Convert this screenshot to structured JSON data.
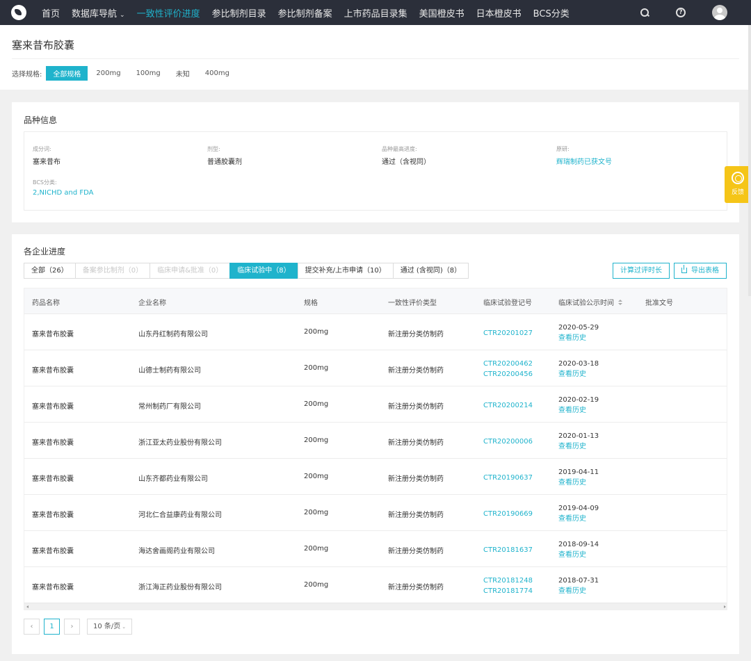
{
  "nav": {
    "items": [
      {
        "label": "首页",
        "active": false
      },
      {
        "label": "数据库导航",
        "active": false,
        "dropdown": true
      },
      {
        "label": "一致性评价进度",
        "active": true
      },
      {
        "label": "参比制剂目录",
        "active": false
      },
      {
        "label": "参比制剂备案",
        "active": false
      },
      {
        "label": "上市药品目录集",
        "active": false
      },
      {
        "label": "美国橙皮书",
        "active": false
      },
      {
        "label": "日本橙皮书",
        "active": false
      },
      {
        "label": "BCS分类",
        "active": false
      }
    ],
    "dropdown_caret": "⌄",
    "help_glyph": "?"
  },
  "header": {
    "title": "塞来昔布胶囊",
    "spec_label": "选择规格:",
    "spec_options": [
      "全部规格",
      "200mg",
      "100mg",
      "未知",
      "400mg"
    ],
    "spec_selected": "全部规格"
  },
  "info": {
    "title": "品种信息",
    "fields": {
      "ingredient": {
        "label": "成分词:",
        "value": "塞来昔布"
      },
      "dosage_form": {
        "label": "剂型:",
        "value": "普通胶囊剂"
      },
      "latest_progress": {
        "label": "品种最高进度:",
        "value": "通过（含视同）"
      },
      "original": {
        "label": "原研:",
        "value": "辉瑞制药已获文号"
      },
      "bcs": {
        "label": "BCS分类:",
        "value": "2,NICHD and FDA"
      }
    }
  },
  "feedback": {
    "label": "反馈"
  },
  "progress": {
    "title": "各企业进度",
    "tabs": [
      {
        "label": "全部（26）",
        "state": "normal"
      },
      {
        "label": "备案参比制剂（0）",
        "state": "disabled"
      },
      {
        "label": "临床申请&批准（0）",
        "state": "disabled"
      },
      {
        "label": "临床试验中（8）",
        "state": "active"
      },
      {
        "label": "提交补充/上市申请（10）",
        "state": "normal"
      },
      {
        "label": "通过 (含视同)（8）",
        "state": "normal"
      }
    ],
    "calc_button": "计算过评时长",
    "export_button": "导出表格",
    "columns": [
      "药品名称",
      "企业名称",
      "规格",
      "一致性评价类型",
      "临床试验登记号",
      "临床试验公示时间",
      "批准文号"
    ],
    "rows": [
      {
        "drug": "塞来昔布胶囊",
        "company": "山东丹红制药有限公司",
        "spec": "200mg",
        "type": "新注册分类仿制药",
        "trial_ids": [
          "CTR20201027"
        ],
        "date": "2020-05-29",
        "history": "查看历史",
        "approval": ""
      },
      {
        "drug": "塞来昔布胶囊",
        "company": "山德士制药有限公司",
        "spec": "200mg",
        "type": "新注册分类仿制药",
        "trial_ids": [
          "CTR20200462",
          "CTR20200456"
        ],
        "date": "2020-03-18",
        "history": "查看历史",
        "approval": ""
      },
      {
        "drug": "塞来昔布胶囊",
        "company": "常州制药厂有限公司",
        "spec": "200mg",
        "type": "新注册分类仿制药",
        "trial_ids": [
          "CTR20200214"
        ],
        "date": "2020-02-19",
        "history": "查看历史",
        "approval": ""
      },
      {
        "drug": "塞来昔布胶囊",
        "company": "浙江亚太药业股份有限公司",
        "spec": "200mg",
        "type": "新注册分类仿制药",
        "trial_ids": [
          "CTR20200006"
        ],
        "date": "2020-01-13",
        "history": "查看历史",
        "approval": ""
      },
      {
        "drug": "塞来昔布胶囊",
        "company": "山东齐都药业有限公司",
        "spec": "200mg",
        "type": "新注册分类仿制药",
        "trial_ids": [
          "CTR20190637"
        ],
        "date": "2019-04-11",
        "history": "查看历史",
        "approval": ""
      },
      {
        "drug": "塞来昔布胶囊",
        "company": "河北仁合益康药业有限公司",
        "spec": "200mg",
        "type": "新注册分类仿制药",
        "trial_ids": [
          "CTR20190669"
        ],
        "date": "2019-04-09",
        "history": "查看历史",
        "approval": ""
      },
      {
        "drug": "塞来昔布胶囊",
        "company": "海达舍画阁药业有限公司",
        "spec": "200mg",
        "type": "新注册分类仿制药",
        "trial_ids": [
          "CTR20181637"
        ],
        "date": "2018-09-14",
        "history": "查看历史",
        "approval": ""
      },
      {
        "drug": "塞来昔布胶囊",
        "company": "浙江海正药业股份有限公司",
        "spec": "200mg",
        "type": "新注册分类仿制药",
        "trial_ids": [
          "CTR20181248",
          "CTR20181774"
        ],
        "date": "2018-07-31",
        "history": "查看历史",
        "approval": ""
      }
    ]
  },
  "pagination": {
    "prev": "‹",
    "next": "›",
    "current_page": "1",
    "page_size": "10 条/页",
    "size_caret": "⌄"
  },
  "colors": {
    "accent": "#1fb3cc",
    "nav_bg": "#2b2f3a",
    "feedback_bg": "#f5c518"
  }
}
